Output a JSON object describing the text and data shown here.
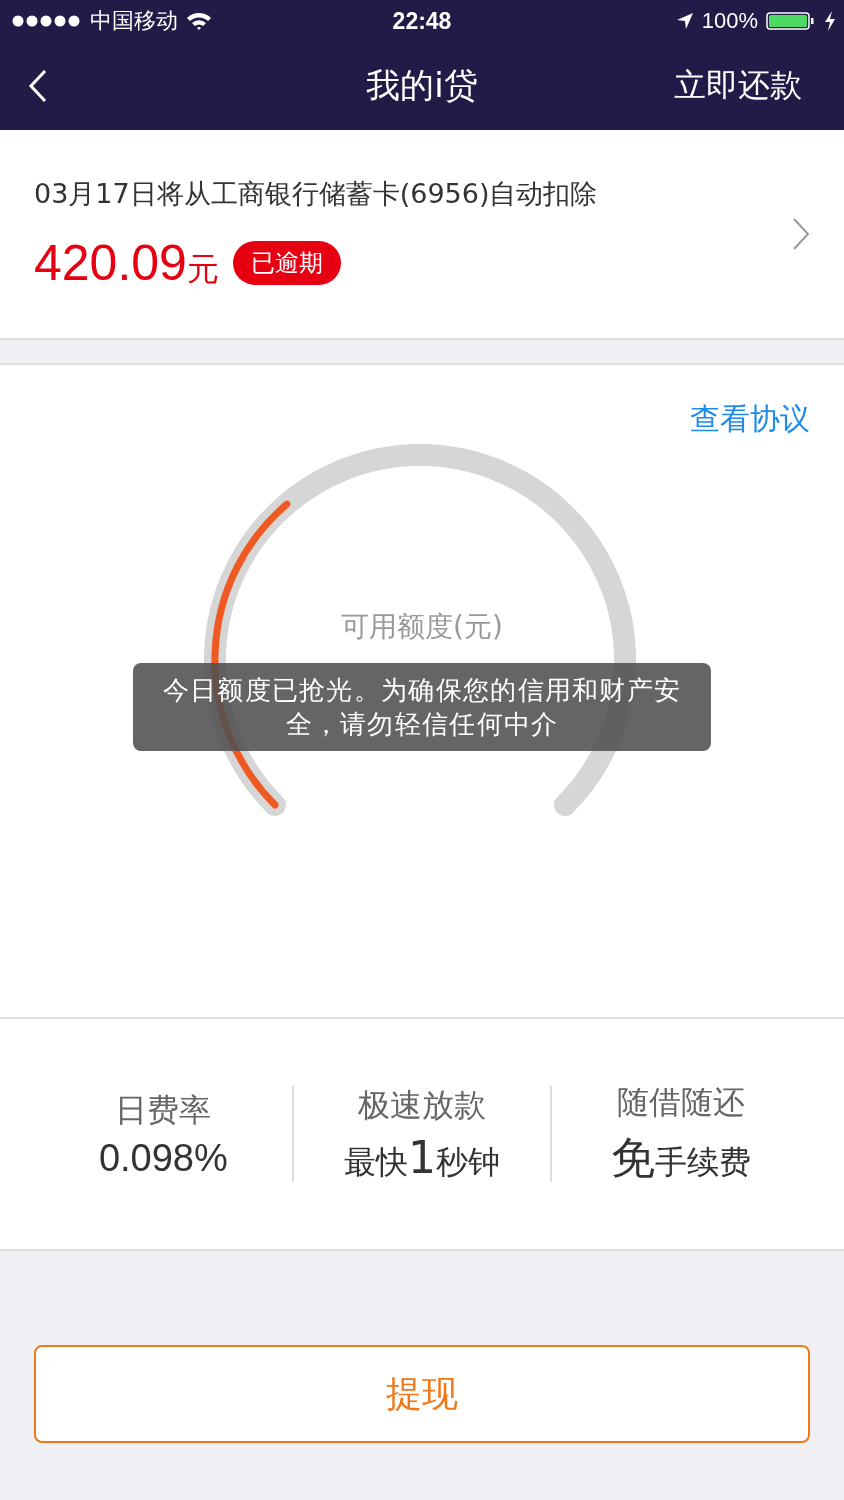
{
  "status_bar": {
    "carrier": "中国移动",
    "time": "22:48",
    "battery": "100%"
  },
  "nav": {
    "title": "我的i贷",
    "action": "立即还款"
  },
  "bill": {
    "due_text": "03月17日将从工商银行储蓄卡(6956)自动扣除",
    "amount": "420.09",
    "unit": "元",
    "badge": "已逾期",
    "overdue": true
  },
  "credit": {
    "agreement_link": "查看协议",
    "label": "可用额度(元)",
    "level": 0.35
  },
  "toast": {
    "message": "今日额度已抢光。为确保您的信用和财产安全，请勿轻信任何中介"
  },
  "features": [
    {
      "title": "日费率",
      "value": [
        {
          "text": "0.098%",
          "emphasis": false
        }
      ]
    },
    {
      "title": "极速放款",
      "value": [
        {
          "text": "最快",
          "emphasis": false
        },
        {
          "text": "1",
          "emphasis": true
        },
        {
          "text": "秒钟",
          "emphasis": false
        }
      ]
    },
    {
      "title": "随借随还",
      "value": [
        {
          "text": "免",
          "emphasis": true
        },
        {
          "text": "手续费",
          "emphasis": false
        }
      ]
    }
  ],
  "primary_button": {
    "label": "提现"
  }
}
